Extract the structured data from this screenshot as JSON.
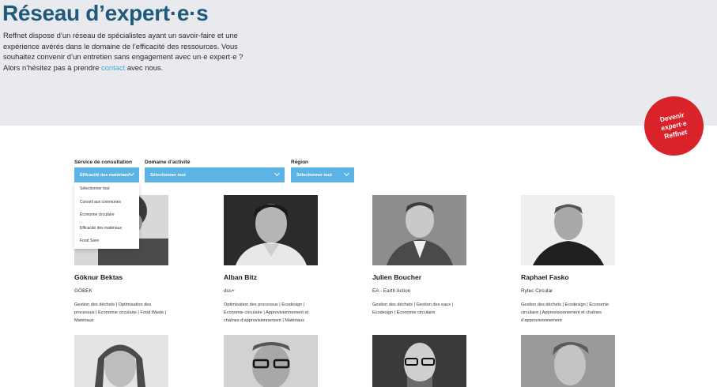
{
  "hero": {
    "title": "Réseau d’expert·e·s",
    "intro_before": "Reffnet dispose d’un réseau de spécialistes ayant un savoir-faire et une expérience avérés dans le domaine de l’efficacité des ressources. Vous souhaitez convenir d’un entretien sans engagement avec un·e expert·e ? Alors n’hésitez pas à prendre ",
    "intro_link": "contact",
    "intro_after": " avec nous."
  },
  "badge": {
    "label": "Devenir expert·e Reffnet",
    "color": "#d9222a"
  },
  "filters": {
    "service": {
      "label": "Service de consultation",
      "value": "Efficacité des matériaux"
    },
    "domain": {
      "label": "Domaine d’activité",
      "value": "Sélectionner tout"
    },
    "region": {
      "label": "Région",
      "value": "Sélectionner tout"
    },
    "dropdown_options": [
      "Sélectionner tout",
      "Conseil aux communes",
      "Économie circulaire",
      "Efficacité des matériaux",
      "Food Save"
    ],
    "accent": "#5bb4e5"
  },
  "experts": [
    {
      "name": "Göknur Bektas",
      "company": "GÖBEK",
      "tags": "Gestion des déchets | Optimisation des processus | Économie circulaire | Food Waste | Matériaux"
    },
    {
      "name": "Alban Bitz",
      "company": "dss+",
      "tags": "Optimisation des processus | Ecodesign | Économie circulaire | Approvisionnement et chaînes d’approvisionnement | Matériaux"
    },
    {
      "name": "Julien Boucher",
      "company": "EA - Earth Action",
      "tags": "Gestion des déchets | Gestion des eaux | Ecodesign | Économie circulaire"
    },
    {
      "name": "Raphael Fasko",
      "company": "Rytec Circular",
      "tags": "Gestion des déchets | Ecodesign | Économie circulaire | Approvisionnement et chaînes d’approvisionnement"
    }
  ],
  "title_color": "#1f5a7a",
  "link_color": "#4aa3d8"
}
